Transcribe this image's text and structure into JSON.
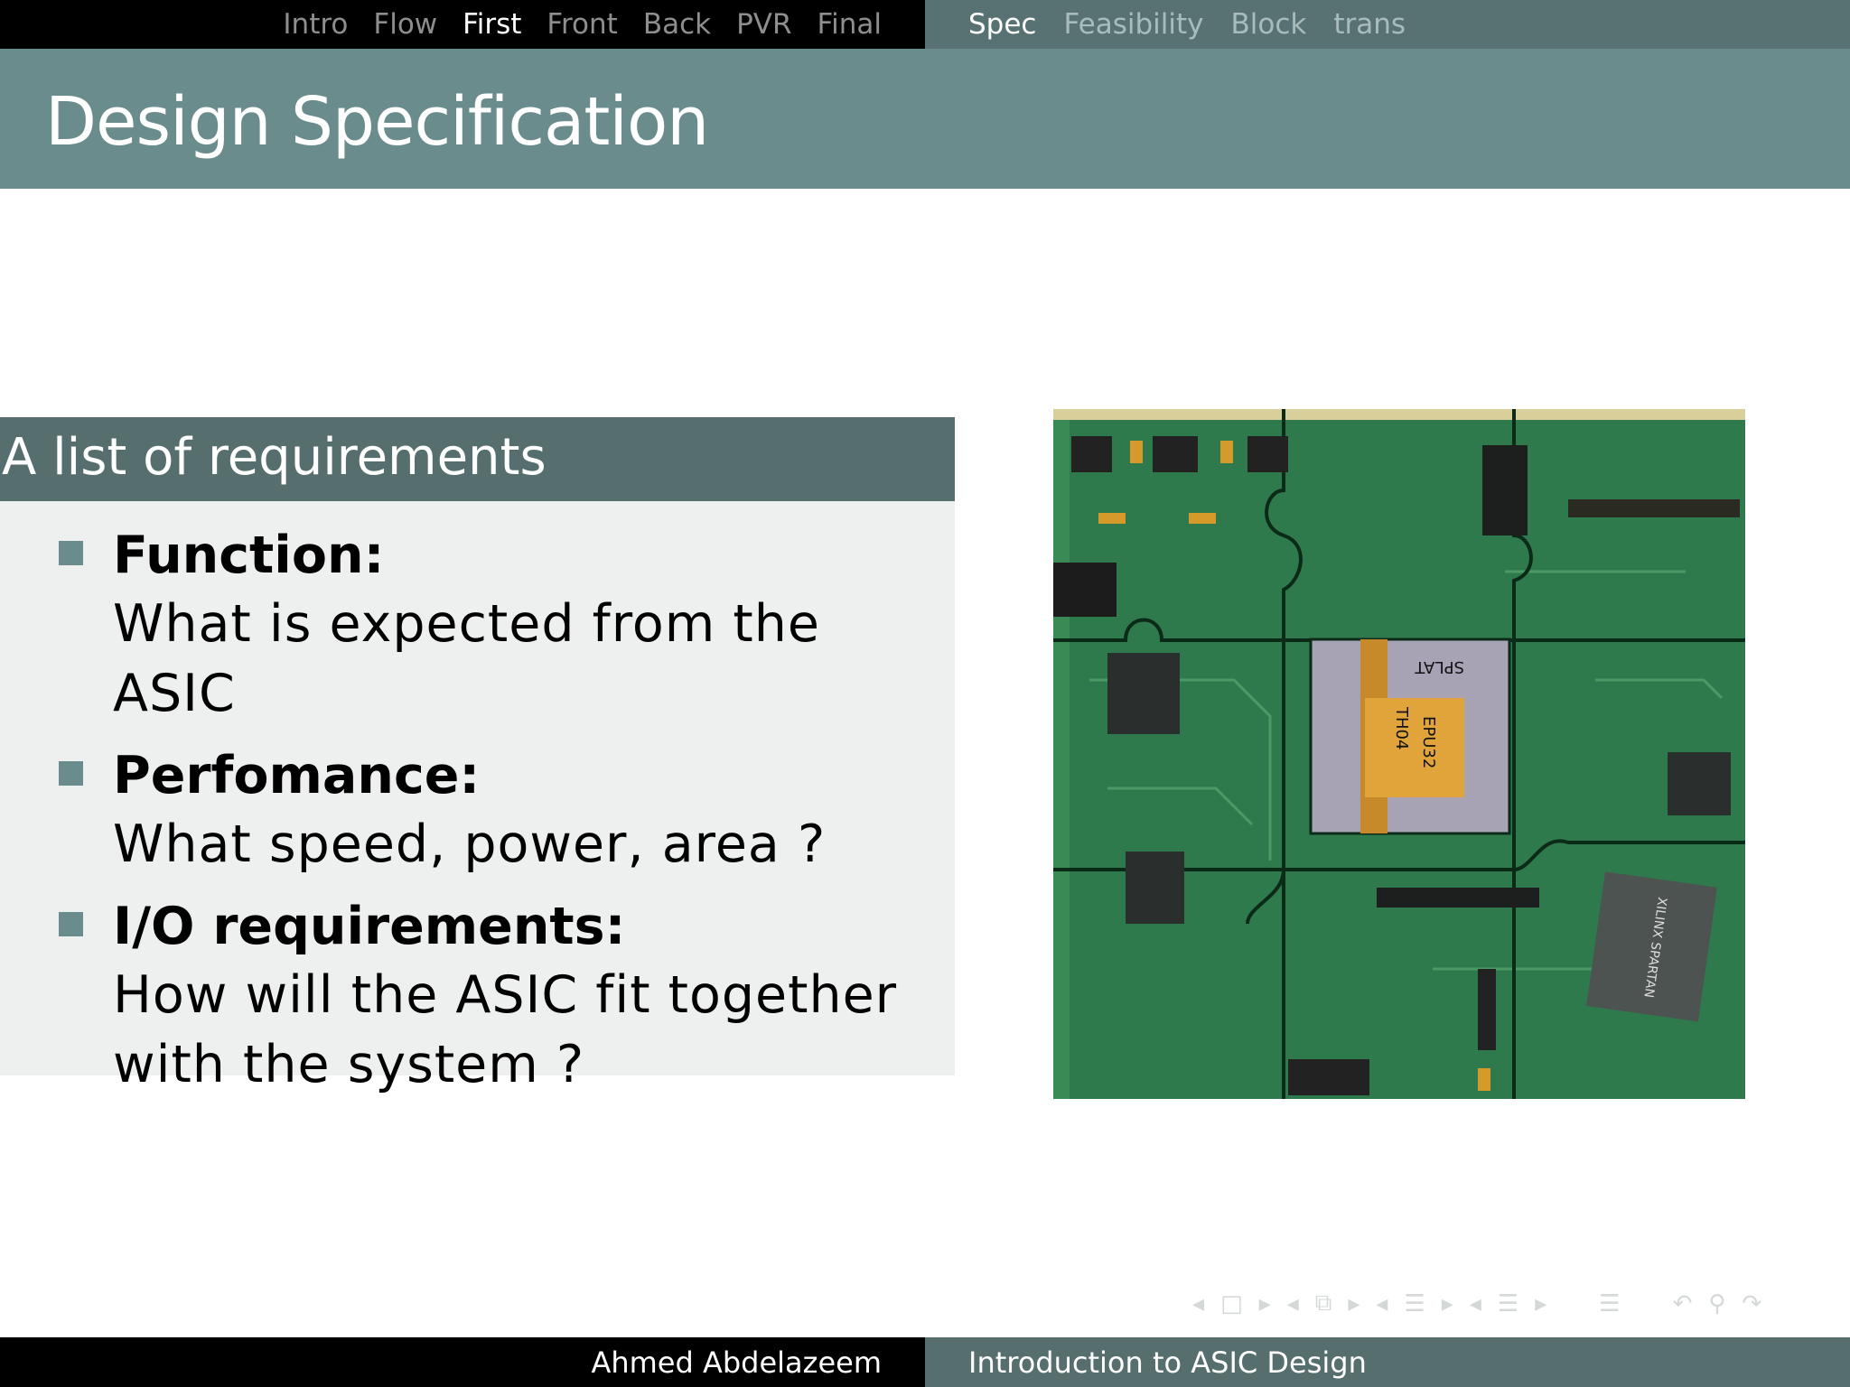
{
  "top_nav": {
    "left_items": [
      {
        "label": "Intro",
        "active": false
      },
      {
        "label": "Flow",
        "active": false
      },
      {
        "label": "First",
        "active": true
      },
      {
        "label": "Front",
        "active": false
      },
      {
        "label": "Back",
        "active": false
      },
      {
        "label": "PVR",
        "active": false
      },
      {
        "label": "Final",
        "active": false
      }
    ],
    "right_items": [
      {
        "label": "Spec",
        "active": true
      },
      {
        "label": "Feasibility",
        "active": false
      },
      {
        "label": "Block",
        "active": false
      },
      {
        "label": "trans",
        "active": false
      }
    ]
  },
  "slide": {
    "title": "Design Specification",
    "block": {
      "title": "A list of requirements",
      "items": [
        {
          "title": "Function:",
          "text": "What is expected from the ASIC"
        },
        {
          "title": "Perfomance:",
          "text": "What speed, power, area ?"
        },
        {
          "title": "I/O requirements:",
          "text": "How will the ASIC fit together with the system ?"
        }
      ]
    },
    "image": {
      "chip_labels": [
        "SPLAT",
        "EPU32",
        "TH04",
        "XILINX SPARTAN"
      ]
    }
  },
  "footer": {
    "author": "Ahmed Abdelazeem",
    "talk_title": "Introduction to ASIC Design"
  },
  "colors": {
    "header": "#6a8c8c",
    "block_title": "#566e6e",
    "block_body": "#eef0ef",
    "board": "#2f7a4c"
  }
}
